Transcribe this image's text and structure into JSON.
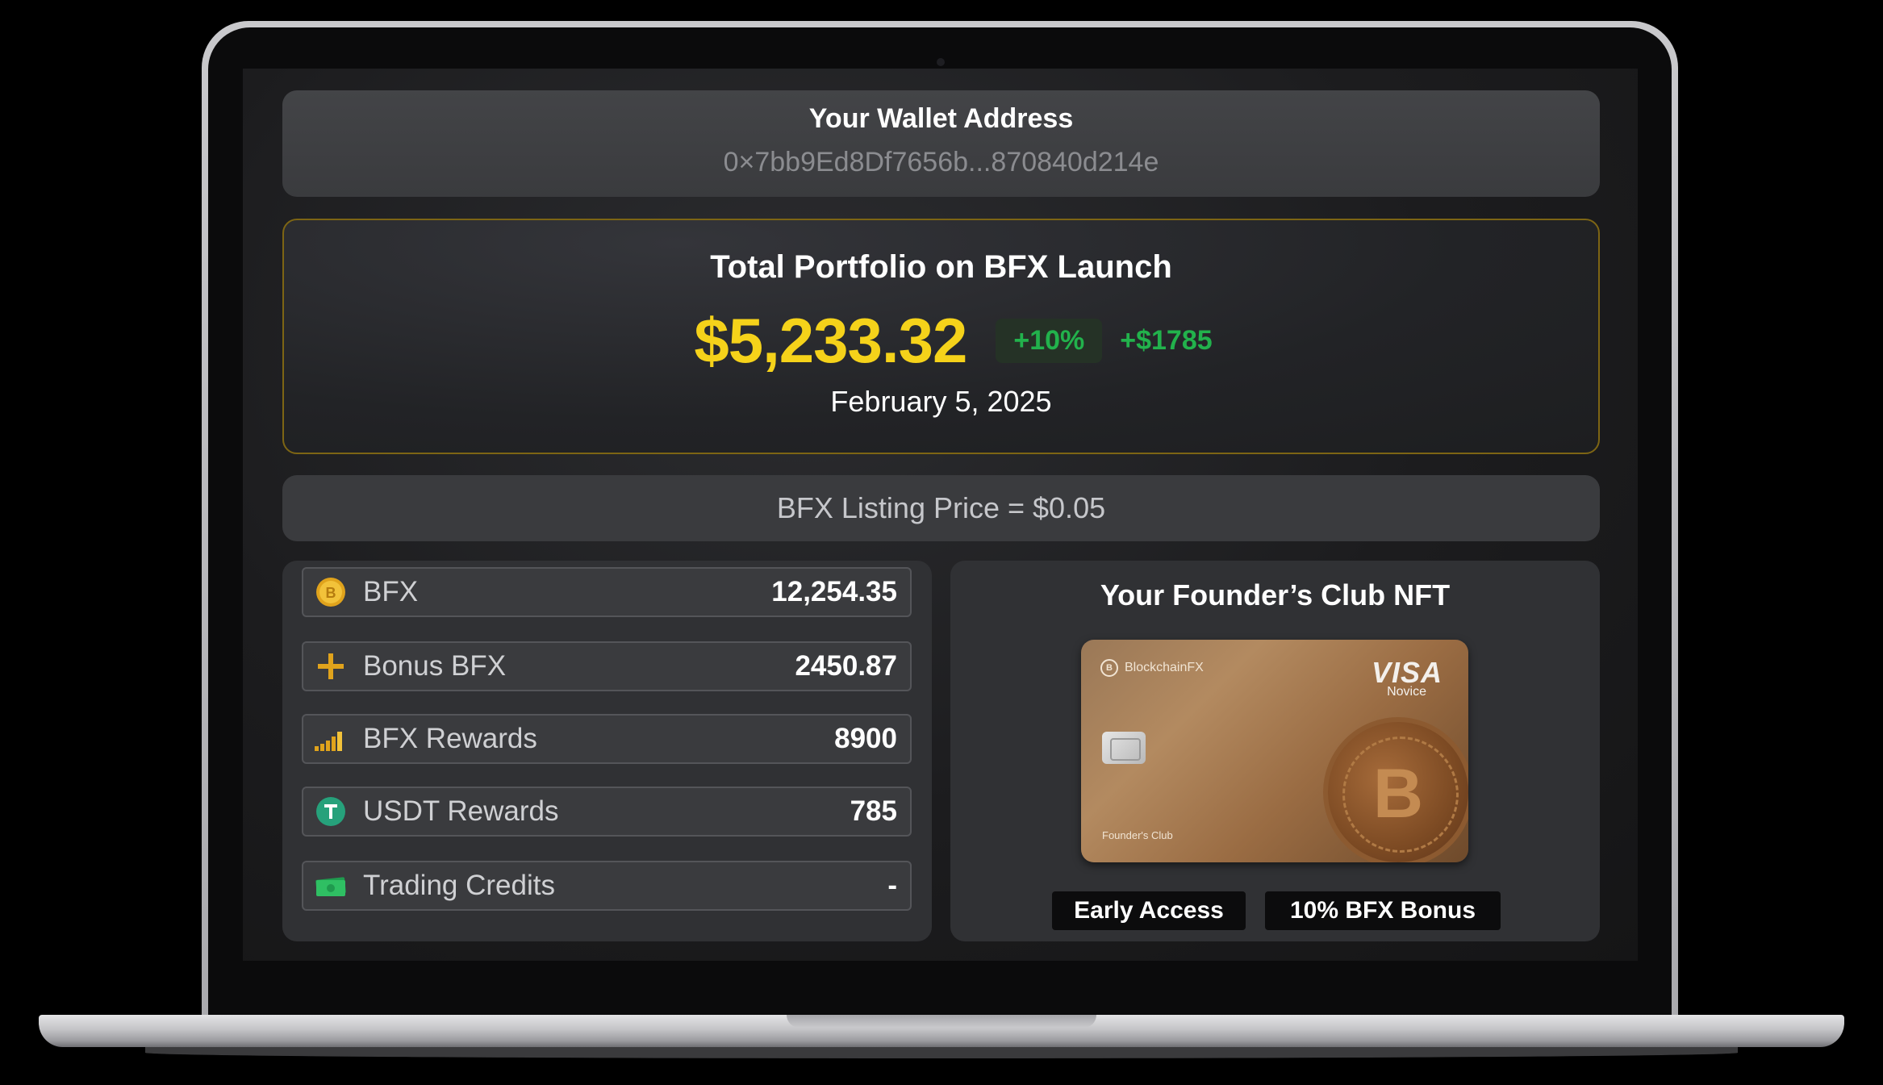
{
  "wallet": {
    "title": "Your Wallet Address",
    "address": "0×7bb9Ed8Df7656b...870840d214e"
  },
  "portfolio": {
    "title": "Total Portfolio on BFX Launch",
    "value": "$5,233.32",
    "change_percent": "+10%",
    "change_amount": "+$1785",
    "date": "February 5, 2025",
    "accent_color": "#f5d21a",
    "positive_color": "#22b24c"
  },
  "listing": {
    "text": "BFX Listing Price = $0.05"
  },
  "balances": [
    {
      "label": "BFX",
      "value": "12,254.35",
      "icon": "bfx-coin-icon"
    },
    {
      "label": "Bonus BFX",
      "value": "2450.87",
      "icon": "plus-icon"
    },
    {
      "label": "BFX Rewards",
      "value": "8900",
      "icon": "signal-bars-icon"
    },
    {
      "label": "USDT Rewards",
      "value": "785",
      "icon": "usdt-coin-icon"
    },
    {
      "label": "Trading Credits",
      "value": "-",
      "icon": "cash-icon"
    }
  ],
  "nft": {
    "title": "Your Founder’s Club NFT",
    "card": {
      "brand": "BlockchainFX",
      "network": "VISA",
      "tier": "Novice",
      "club": "Founder's Club"
    },
    "tags": [
      "Early Access",
      "10% BFX Bonus"
    ]
  }
}
